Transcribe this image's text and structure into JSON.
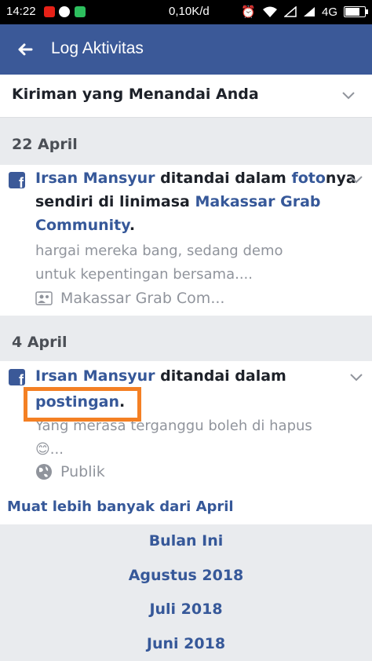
{
  "status_bar": {
    "time": "14:22",
    "net_speed": "0,10K/d",
    "network": "4G"
  },
  "app_bar": {
    "title": "Log Aktivitas"
  },
  "filter": {
    "label": "Kiriman yang Menandai Anda"
  },
  "sections": [
    {
      "date": "22 April",
      "entry": {
        "actor": "Irsan Mansyur",
        "text1": " ditandai dalam ",
        "link1": "foto",
        "text2": "nya",
        "line2_text": "sendiri di linimasa ",
        "line2_link": "Makassar Grab",
        "line3_link": "Community",
        "line3_end": ".",
        "snippet1": "hargai mereka bang,  sedang demo",
        "snippet2": "untuk kepentingan bersama....",
        "meta": "Makassar Grab Com..."
      }
    },
    {
      "date": "4 April",
      "entry": {
        "actor": "Irsan Mansyur",
        "text1": " ditandai dalam",
        "line2_link": "postingan",
        "line2_end": ".",
        "snippet1": "Yang merasa terganggu boleh di hapus",
        "snippet2": "😊...",
        "meta": "Publik"
      }
    }
  ],
  "load_more": "Muat lebih banyak dari April",
  "months": [
    "Bulan Ini",
    "Agustus 2018",
    "Juli 2018",
    "Juni 2018"
  ],
  "colors": {
    "brand": "#3b5998",
    "link": "#365899",
    "highlight": "#f48024"
  },
  "icons": [
    "back-arrow-icon",
    "chevron-down-icon",
    "facebook-icon",
    "group-icon",
    "globe-icon"
  ]
}
